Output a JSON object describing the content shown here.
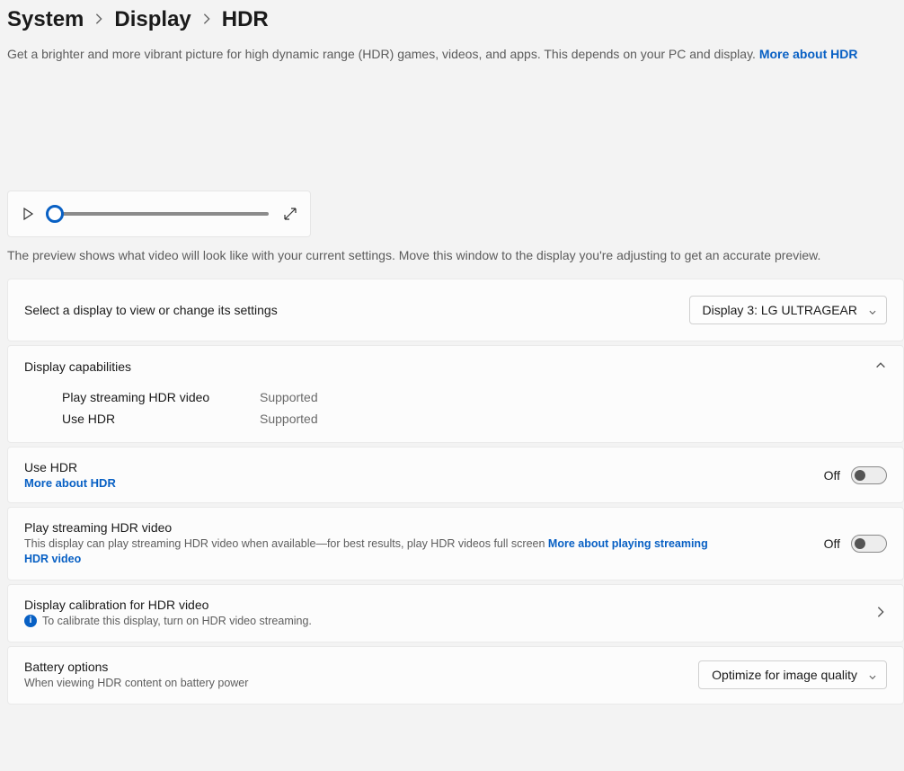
{
  "breadcrumb": {
    "seg1": "System",
    "seg2": "Display",
    "current": "HDR"
  },
  "description": "Get a brighter and more vibrant picture for high dynamic range (HDR) games, videos, and apps. This depends on your PC and display. ",
  "description_link": "More about HDR",
  "preview_note": "The preview shows what video will look like with your current settings. Move this window to the display you're adjusting to get an accurate preview.",
  "select_display": {
    "label": "Select a display to view or change its settings",
    "value": "Display 3: LG ULTRAGEAR"
  },
  "capabilities": {
    "header": "Display capabilities",
    "rows": [
      {
        "k": "Play streaming HDR video",
        "v": "Supported"
      },
      {
        "k": "Use HDR",
        "v": "Supported"
      }
    ]
  },
  "use_hdr": {
    "title": "Use HDR",
    "more": "More about HDR",
    "state": "Off"
  },
  "play_stream": {
    "title": "Play streaming HDR video",
    "sub": "This display can play streaming HDR video when available—for best results, play HDR videos full screen  ",
    "more": "More about playing streaming HDR video",
    "state": "Off"
  },
  "calibration": {
    "title": "Display calibration for HDR video",
    "info": "To calibrate this display, turn on HDR video streaming."
  },
  "battery": {
    "title": "Battery options",
    "sub": "When viewing HDR content on battery power",
    "value": "Optimize for image quality"
  }
}
